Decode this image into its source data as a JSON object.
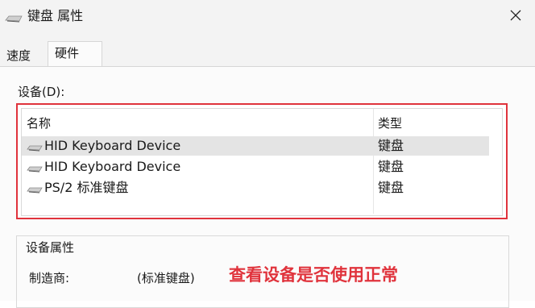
{
  "window": {
    "title": "键盘 属性",
    "close_symbol": "×"
  },
  "tabs": [
    {
      "label": "速度",
      "active": false
    },
    {
      "label": "硬件",
      "active": true
    }
  ],
  "devices": {
    "label": "设备(D):",
    "columns": [
      "名称",
      "类型"
    ],
    "rows": [
      {
        "name": "HID Keyboard Device",
        "type": "键盘",
        "selected": true
      },
      {
        "name": "HID Keyboard Device",
        "type": "键盘",
        "selected": false
      },
      {
        "name": "PS/2 标准键盘",
        "type": "键盘",
        "selected": false
      }
    ]
  },
  "properties": {
    "title": "设备属性",
    "manufacturer_label": "制造商:",
    "manufacturer_value": "(标准键盘)"
  },
  "annotation": "查看设备是否使用正常",
  "colors": {
    "highlight_red": "#e0333c",
    "selection": "#e4e4e4"
  },
  "icons": {
    "keyboard": "keyboard-icon",
    "close": "close-icon"
  }
}
